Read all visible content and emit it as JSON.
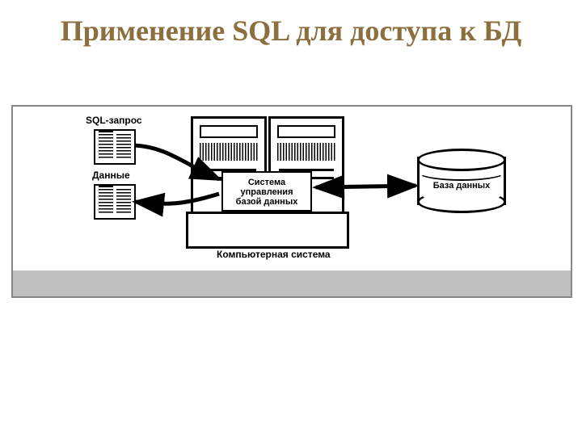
{
  "title": "Применение SQL для доступа к БД",
  "labels": {
    "sql_query": "SQL-запрос",
    "data": "Данные",
    "dbms_line1": "Система",
    "dbms_line2": "управления",
    "dbms_line3": "базой данных",
    "database": "База данных",
    "computer_system": "Компьютерная система"
  },
  "diagram": {
    "components": [
      {
        "id": "sql-query-doc",
        "type": "document",
        "label_key": "sql_query"
      },
      {
        "id": "data-doc",
        "type": "document",
        "label_key": "data"
      },
      {
        "id": "computer-system",
        "type": "computer",
        "label_key": "computer_system"
      },
      {
        "id": "dbms-box",
        "type": "box",
        "label_keys": [
          "dbms_line1",
          "dbms_line2",
          "dbms_line3"
        ]
      },
      {
        "id": "database-cylinder",
        "type": "cylinder",
        "label_key": "database"
      }
    ],
    "arrows": [
      {
        "from": "sql-query-doc",
        "to": "dbms-box",
        "bidirectional": false
      },
      {
        "from": "dbms-box",
        "to": "data-doc",
        "bidirectional": false
      },
      {
        "from": "dbms-box",
        "to": "database-cylinder",
        "bidirectional": true
      }
    ]
  }
}
